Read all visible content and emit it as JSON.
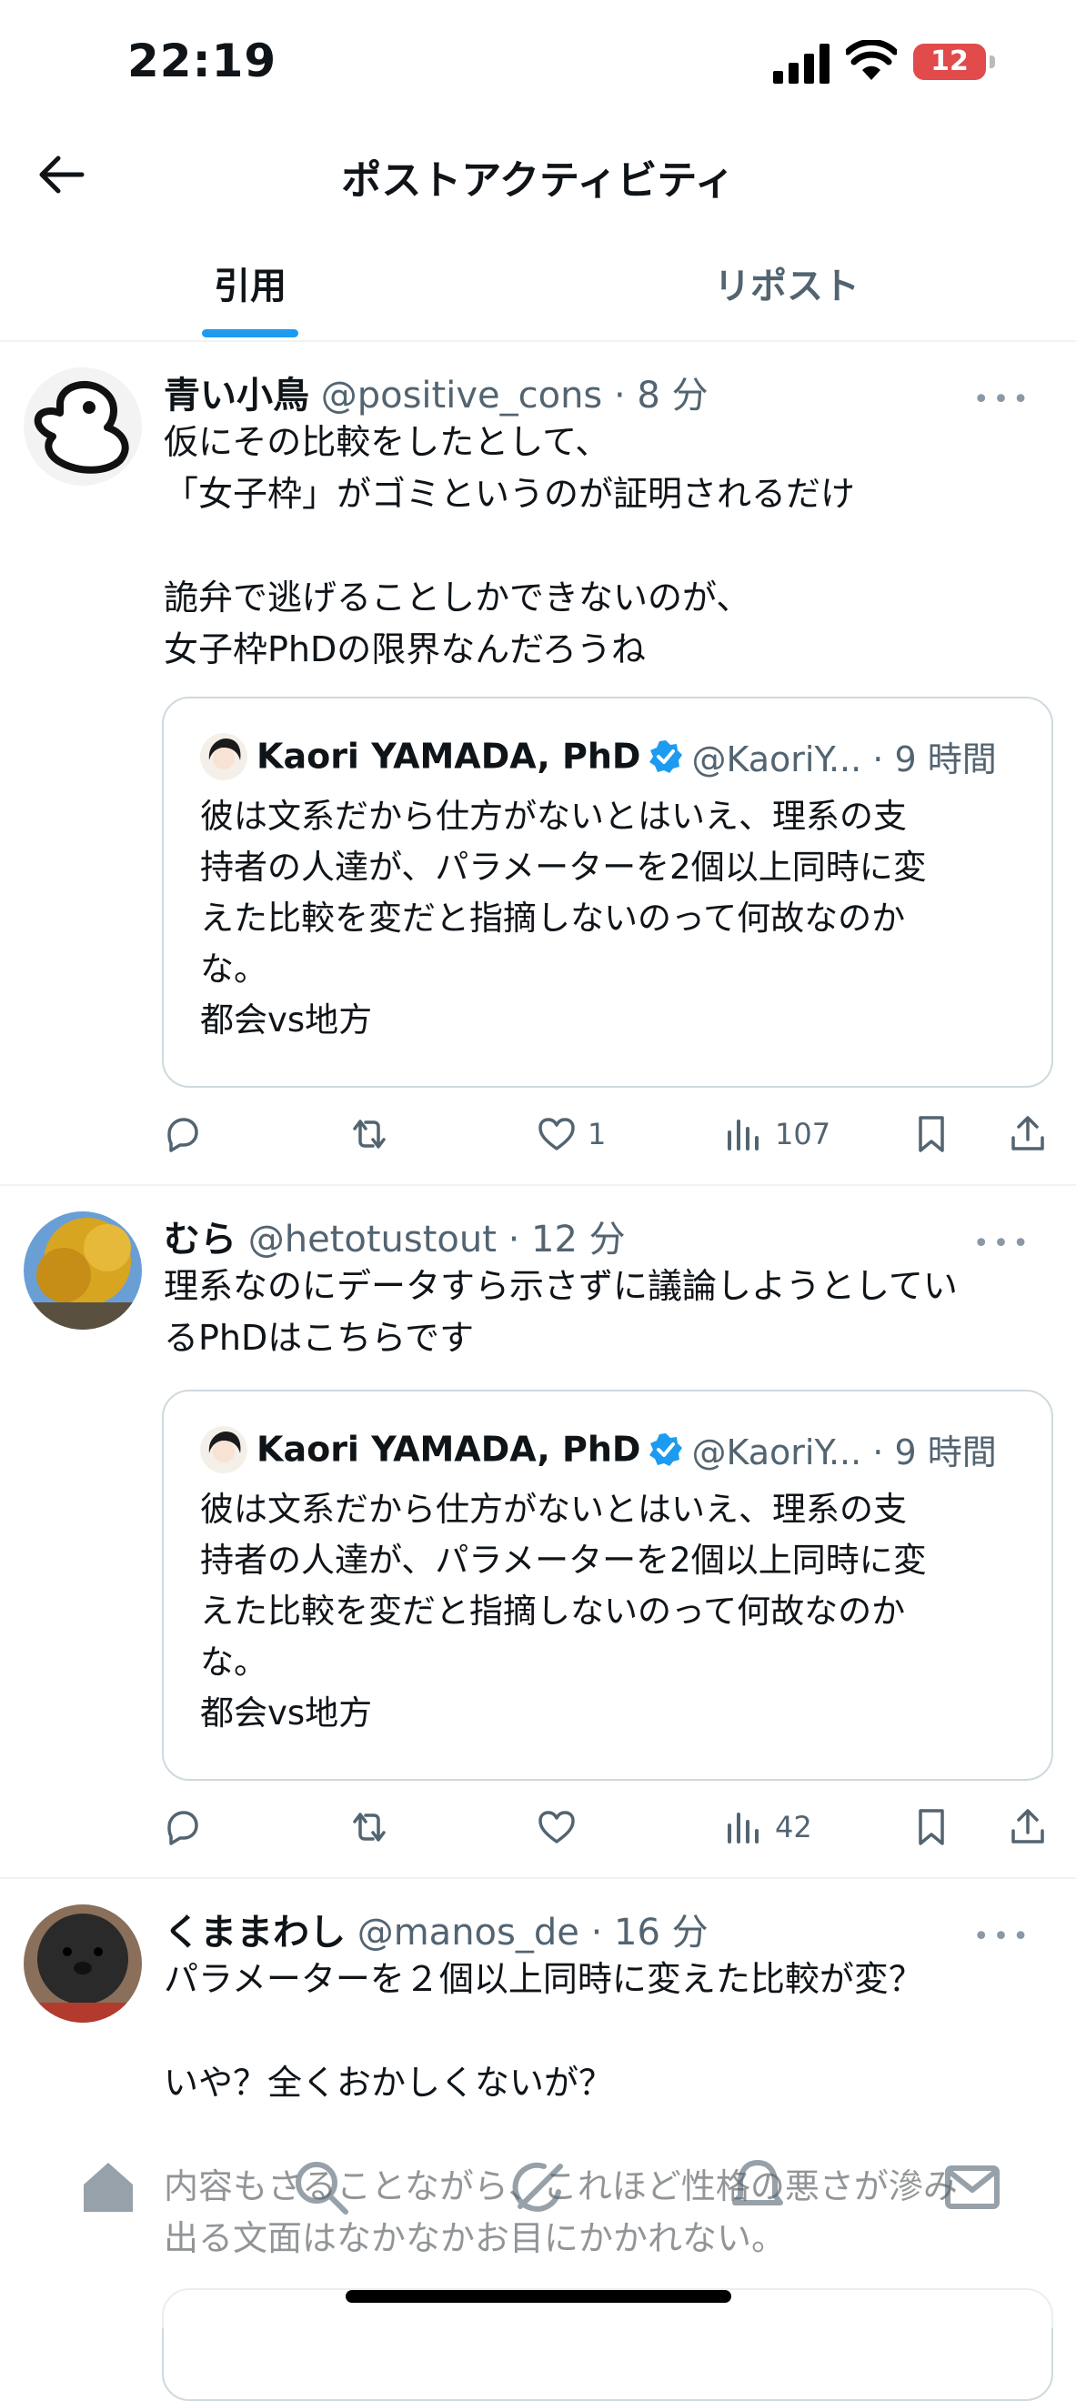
{
  "status_bar": {
    "time": "22:19",
    "battery": "12"
  },
  "header": {
    "title": "ポストアクティビティ"
  },
  "tabs": [
    {
      "label": "引用"
    },
    {
      "label": "リポスト"
    }
  ],
  "quoted_post": {
    "name": "Kaori YAMADA, PhD",
    "meta": "@KaoriY... · 9 時間",
    "text": "彼は文系だから仕方がないとはいえ、理系の支\n持者の人達が、パラメーターを2個以上同時に変\nえた比較を変だと指摘しないのって何故なのか\nな。\n都会vs地方"
  },
  "posts": [
    {
      "name": "青い小鳥",
      "meta": " @positive_cons · 8 分",
      "text": "仮にその比較をしたとして、\n「女子枠」がゴミというのが証明されるだけ\n\n詭弁で逃げることしかできないのが、\n女子枠PhDの限界なんだろうね",
      "likes": "1",
      "views": "107"
    },
    {
      "name": "むら",
      "meta": " @hetotustout · 12 分",
      "text": "理系なのにデータすら示さずに議論しようとしてい\nるPhDはこちらです",
      "likes": "",
      "views": "42"
    },
    {
      "name": "くままわし",
      "meta": " @manos_de · 16 分",
      "text": "パラメーターを２個以上同時に変えた比較が変？\n\nいや？全くおかしくないが？\n\n内容もさることながら、これほど性格の悪さが滲み\n出る文面はなかなかお目にかかれない。"
    }
  ],
  "colors": {
    "accent": "#1d9bf0",
    "secondary_text": "#536471",
    "battery_low": "#e14b4b"
  }
}
